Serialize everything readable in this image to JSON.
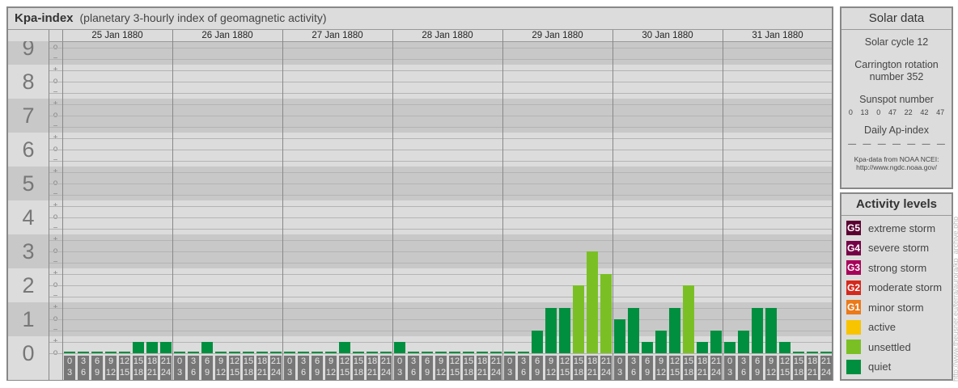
{
  "header": {
    "title": "Kpa-index",
    "subtitle": "(planetary 3-hourly index of geomagnetic activity)"
  },
  "solar": {
    "title": "Solar data",
    "cycle": "Solar cycle 12",
    "carrington_1": "Carrington rotation",
    "carrington_2": "number 352",
    "sunspot_title": "Sunspot number",
    "sunspots": [
      "0",
      "13",
      "0",
      "47",
      "22",
      "42",
      "47"
    ],
    "ap_title": "Daily Ap-index",
    "ap": [
      "—",
      "—",
      "—",
      "—",
      "—",
      "—",
      "—"
    ],
    "source_1": "Kpa-data from NOAA NCEI:",
    "source_2": "http://www.ngdc.noaa.gov/"
  },
  "levels": {
    "title": "Activity levels",
    "items": [
      {
        "badge": "G5",
        "label": "extreme storm",
        "color": "#5a0030"
      },
      {
        "badge": "G4",
        "label": "severe storm",
        "color": "#760046"
      },
      {
        "badge": "G3",
        "label": "strong storm",
        "color": "#a8005a"
      },
      {
        "badge": "G2",
        "label": "moderate storm",
        "color": "#d5281c"
      },
      {
        "badge": "G1",
        "label": "minor storm",
        "color": "#ea7a1a"
      },
      {
        "badge": "",
        "label": "active",
        "color": "#f8c400"
      },
      {
        "badge": "",
        "label": "unsettled",
        "color": "#7ac024"
      },
      {
        "badge": "",
        "label": "quiet",
        "color": "#008f3f"
      }
    ]
  },
  "watermark": "http://www.theusner.eu/terra/aurora/kp_archive.php",
  "chart_data": {
    "type": "bar",
    "title": "Kpa-index",
    "ylim": [
      0,
      9
    ],
    "y_ticks": [
      "0",
      "1",
      "2",
      "3",
      "4",
      "5",
      "6",
      "7",
      "8",
      "9"
    ],
    "sub_ticks": [
      "+",
      "o",
      "−"
    ],
    "intervals": [
      [
        "0",
        "3"
      ],
      [
        "3",
        "6"
      ],
      [
        "6",
        "9"
      ],
      [
        "9",
        "12"
      ],
      [
        "12",
        "15"
      ],
      [
        "15",
        "18"
      ],
      [
        "18",
        "21"
      ],
      [
        "21",
        "24"
      ]
    ],
    "days": [
      {
        "date": "25 Jan 1880",
        "kp": [
          "0o",
          "0o",
          "0o",
          "0o",
          "0o",
          "0+",
          "0+",
          "0+"
        ]
      },
      {
        "date": "26 Jan 1880",
        "kp": [
          "0o",
          "0o",
          "0+",
          "0o",
          "0o",
          "0o",
          "0o",
          "0o"
        ]
      },
      {
        "date": "27 Jan 1880",
        "kp": [
          "0o",
          "0o",
          "0o",
          "0o",
          "0+",
          "0o",
          "0o",
          "0o"
        ]
      },
      {
        "date": "28 Jan 1880",
        "kp": [
          "0+",
          "0o",
          "0o",
          "0o",
          "0o",
          "0o",
          "0o",
          "0o"
        ]
      },
      {
        "date": "29 Jan 1880",
        "kp": [
          "0o",
          "0o",
          "1-",
          "1+",
          "1+",
          "2o",
          "3o",
          "2+"
        ]
      },
      {
        "date": "30 Jan 1880",
        "kp": [
          "1o",
          "1+",
          "0+",
          "1-",
          "1+",
          "2o",
          "0+",
          "1-"
        ]
      },
      {
        "date": "31 Jan 1880",
        "kp": [
          "0+",
          "1-",
          "1+",
          "1+",
          "0+",
          "0o",
          "0o",
          "0o"
        ]
      }
    ],
    "colors": {
      "quiet": "#008f3f",
      "unsettled": "#7ac024",
      "active": "#f8c400"
    }
  }
}
